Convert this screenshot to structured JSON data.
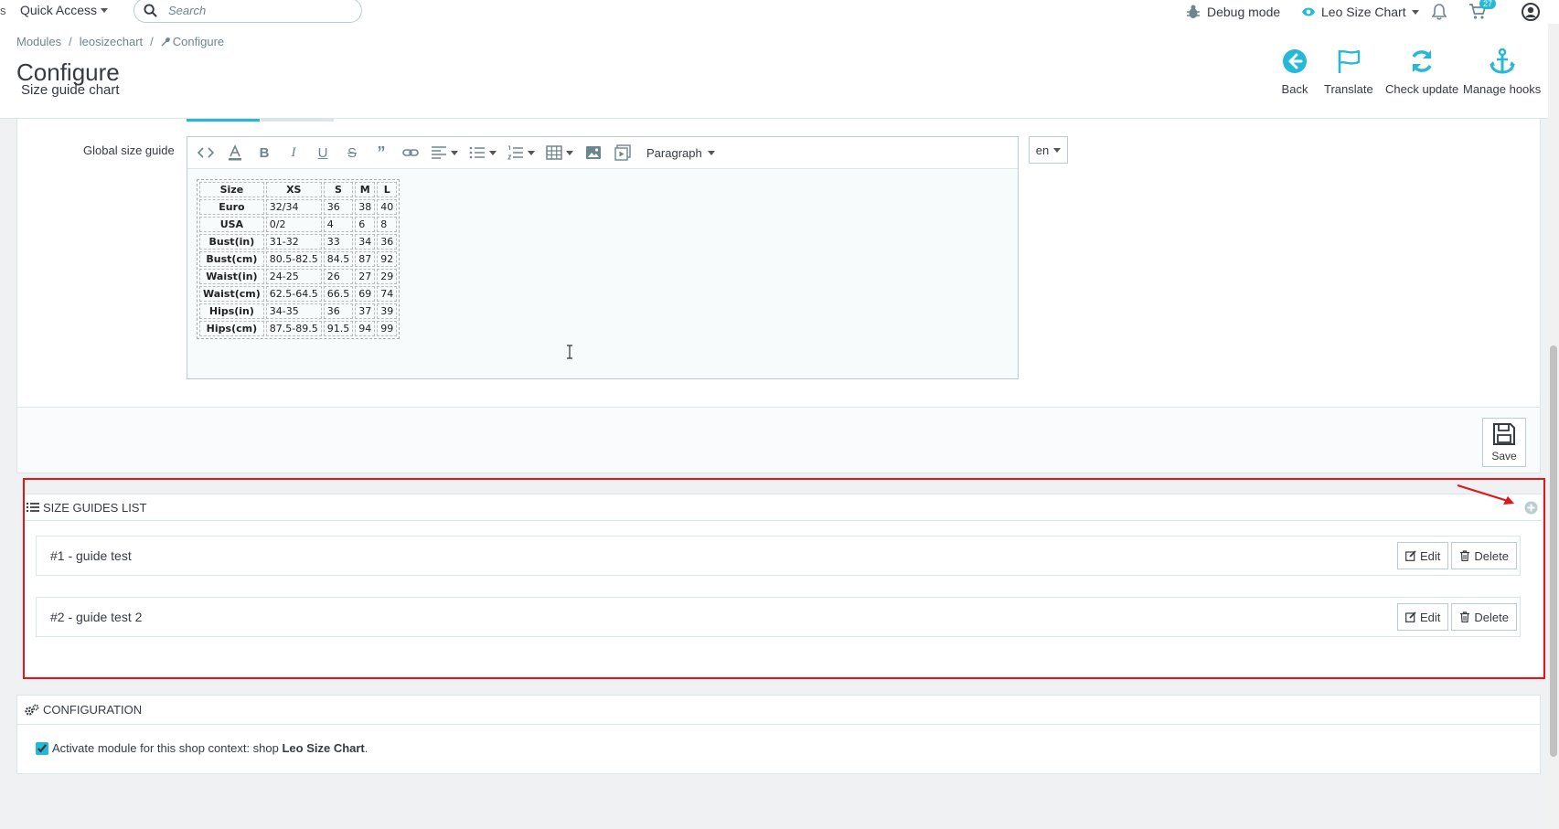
{
  "topbar": {
    "edge_glyph": "s",
    "quick_access": "Quick Access",
    "search_placeholder": "Search",
    "debug_mode": "Debug mode",
    "shop_name": "Leo Size Chart",
    "cart_count": "27"
  },
  "breadcrumb": [
    "Modules",
    "leosizechart",
    "Configure"
  ],
  "header": {
    "title": "Configure",
    "subtitle": "Size guide chart",
    "actions": {
      "back": "Back",
      "translate": "Translate",
      "check_update": "Check update",
      "manage_hooks": "Manage hooks"
    }
  },
  "form": {
    "field_label": "Global size guide",
    "paragraph_format": "Paragraph",
    "language": "en",
    "save_label": "Save"
  },
  "size_table": {
    "header": [
      "Size",
      "XS",
      "S",
      "M",
      "L"
    ],
    "rows": [
      [
        "Euro",
        "32/34",
        "36",
        "38",
        "40"
      ],
      [
        "USA",
        "0/2",
        "4",
        "6",
        "8"
      ],
      [
        "Bust(in)",
        "31-32",
        "33",
        "34",
        "36"
      ],
      [
        "Bust(cm)",
        "80.5-82.5",
        "84.5",
        "87",
        "92"
      ],
      [
        "Waist(in)",
        "24-25",
        "26",
        "27",
        "29"
      ],
      [
        "Waist(cm)",
        "62.5-64.5",
        "66.5",
        "69",
        "74"
      ],
      [
        "Hips(in)",
        "34-35",
        "36",
        "37",
        "39"
      ],
      [
        "Hips(cm)",
        "87.5-89.5",
        "91.5",
        "94",
        "99"
      ]
    ]
  },
  "size_guides": {
    "title": "SIZE GUIDES LIST",
    "items": [
      {
        "name": "#1 - guide test",
        "edit": "Edit",
        "delete": "Delete"
      },
      {
        "name": "#2 - guide test 2",
        "edit": "Edit",
        "delete": "Delete"
      }
    ]
  },
  "configuration": {
    "title": "CONFIGURATION",
    "checkbox_text": "Activate module for this shop context: shop ",
    "shop_bold": "Leo Size Chart",
    "checkbox_suffix": ".",
    "checked": true
  },
  "colors": {
    "accent": "#25b9d7",
    "highlight": "#e3151a",
    "text": "#363a41"
  }
}
